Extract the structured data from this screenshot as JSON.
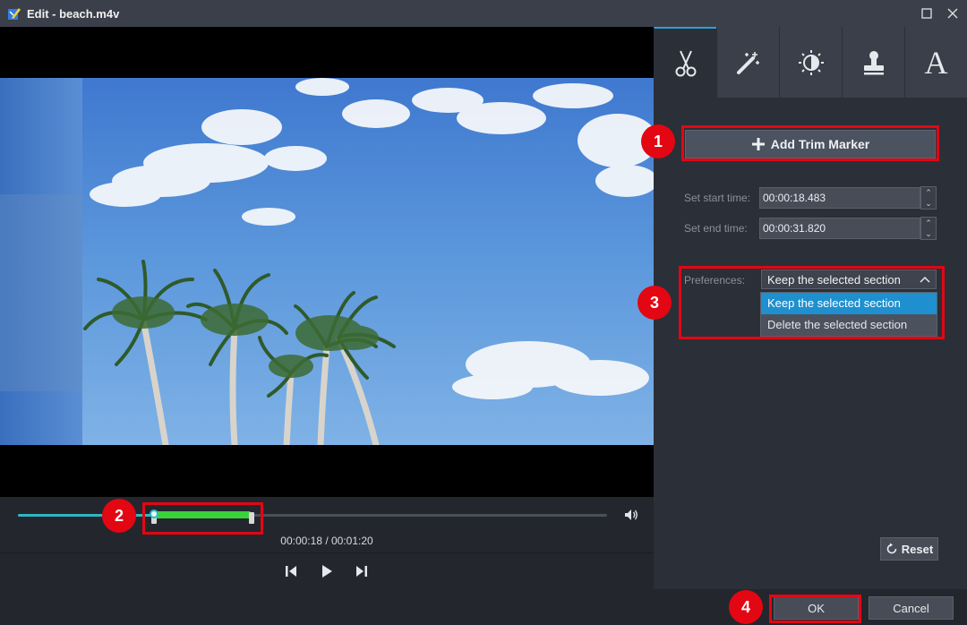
{
  "window": {
    "title": "Edit - beach.m4v"
  },
  "icons": {
    "app": "app-edit-icon",
    "maximize": "maximize-icon",
    "close": "close-icon",
    "volume": "volume-icon",
    "prev_frame": "previous-frame-icon",
    "play": "play-icon",
    "next_frame": "next-frame-icon",
    "plus": "plus-icon",
    "reset": "reset-icon"
  },
  "player": {
    "time_current": "00:00:18",
    "time_total": "00:01:20",
    "time_display": "00:00:18 / 00:01:20",
    "playback_fraction": 0.228
  },
  "tabs": [
    {
      "name": "trim",
      "icon": "scissors-icon",
      "active": true
    },
    {
      "name": "effect",
      "icon": "magic-wand-icon",
      "active": false
    },
    {
      "name": "adjust",
      "icon": "brightness-icon",
      "active": false
    },
    {
      "name": "watermark",
      "icon": "stamp-icon",
      "active": false
    },
    {
      "name": "text",
      "icon": "text-icon",
      "label": "A",
      "active": false
    }
  ],
  "trim": {
    "add_marker_label": "Add Trim Marker",
    "start_label": "Set start time:",
    "start_value": "00:00:18.483",
    "end_label": "Set end time:",
    "end_value": "00:00:31.820",
    "preferences_label": "Preferences:",
    "preferences_selected": "Keep the selected section",
    "preferences_options": [
      "Keep the selected section",
      "Delete the selected section"
    ],
    "reset_label": "Reset"
  },
  "footer": {
    "ok_label": "OK",
    "cancel_label": "Cancel"
  },
  "annotations": [
    {
      "number": "1"
    },
    {
      "number": "2"
    },
    {
      "number": "3"
    },
    {
      "number": "4"
    }
  ],
  "colors": {
    "accent": "#1e8fcf",
    "trim_range": "#3ad13a",
    "seek_played": "#2fb8c4",
    "annotation": "#e30613"
  }
}
